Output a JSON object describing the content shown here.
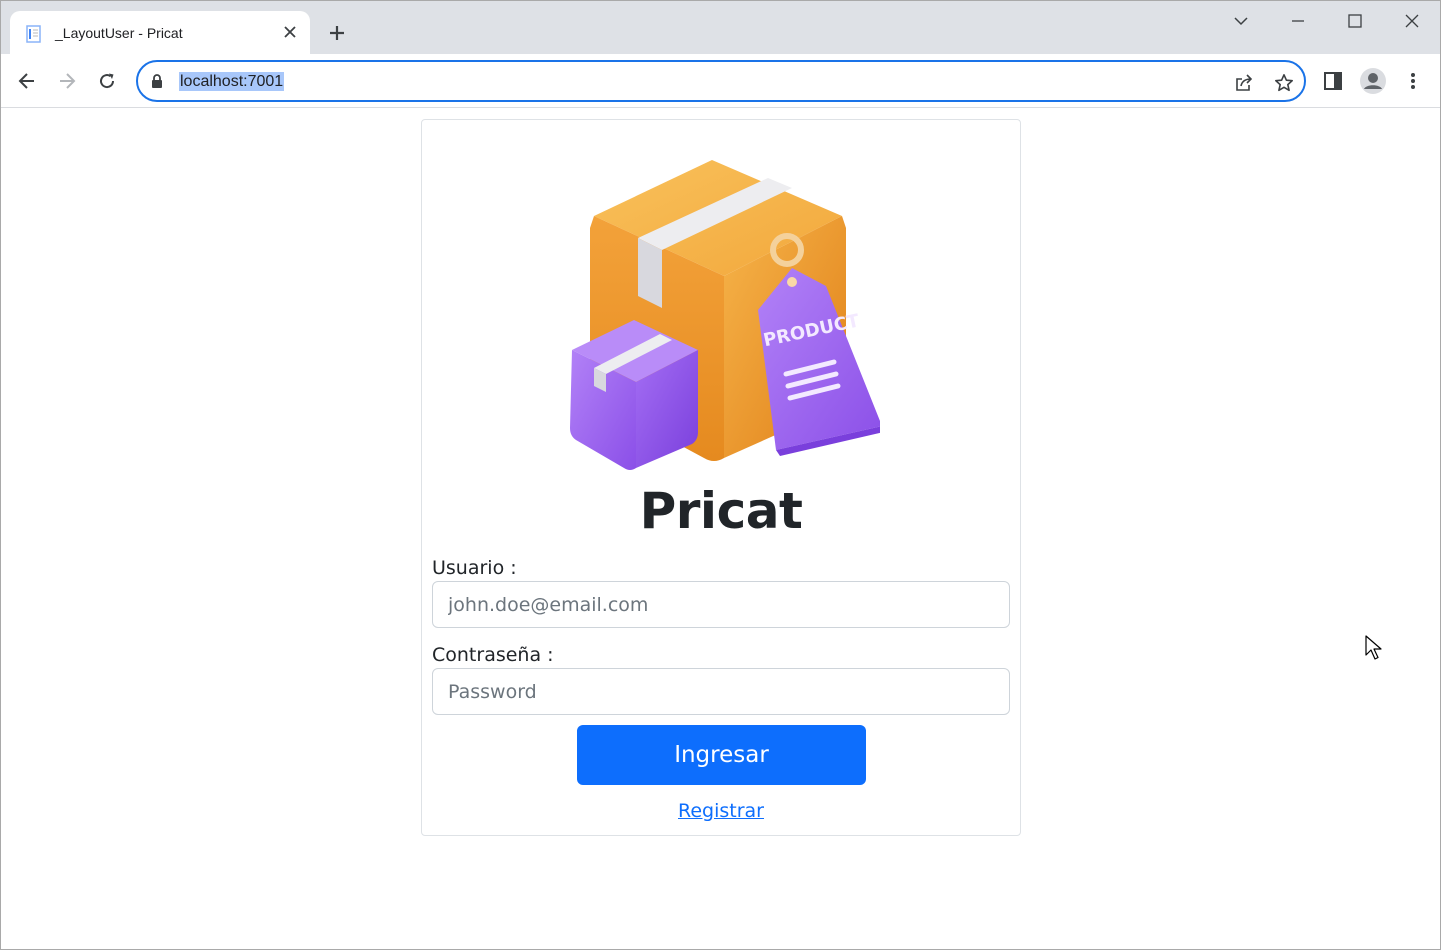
{
  "browser": {
    "tab": {
      "title": "_LayoutUser - Pricat"
    },
    "address": {
      "url": "localhost:7001"
    }
  },
  "login": {
    "logo": {
      "tag_text": "PRODUCT"
    },
    "brand": "Pricat",
    "username": {
      "label": "Usuario :",
      "placeholder": "john.doe@email.com",
      "value": ""
    },
    "password": {
      "label": "Contraseña :",
      "placeholder": "Password",
      "value": ""
    },
    "submit_label": "Ingresar",
    "register_label": "Registrar"
  },
  "colors": {
    "primary": "#0d6efd",
    "box_orange": "#f0a23a",
    "box_purple": "#9b5cf0",
    "tab_strip": "#dee1e6",
    "focus_ring": "#1a73e8"
  },
  "icons": [
    "page-icon",
    "close-icon",
    "plus-icon",
    "chevron-down-icon",
    "minimize-icon",
    "maximize-icon",
    "window-close-icon",
    "back-arrow-icon",
    "forward-arrow-icon",
    "reload-icon",
    "lock-icon",
    "share-icon",
    "star-icon",
    "side-panel-icon",
    "profile-icon",
    "kebab-menu-icon",
    "mouse-cursor-icon"
  ]
}
